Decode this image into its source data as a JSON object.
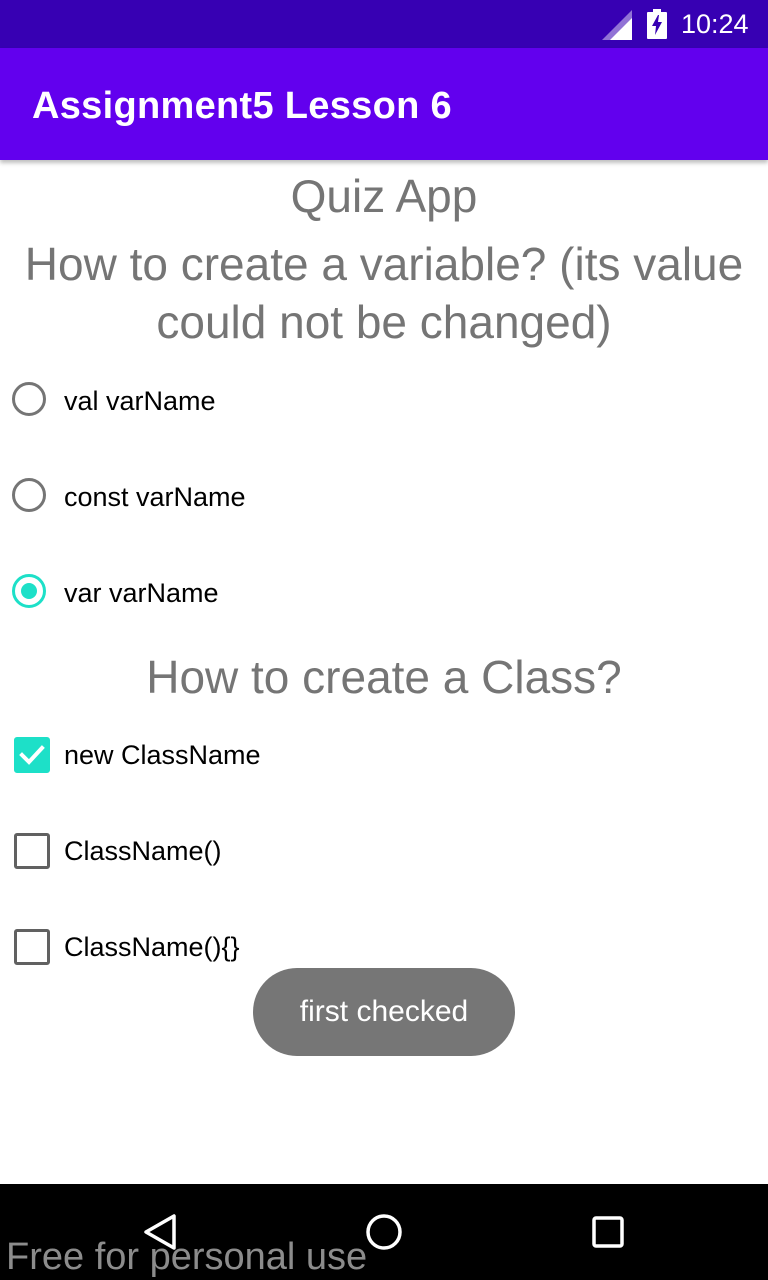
{
  "status_bar": {
    "time": "10:24",
    "icons": [
      "signal-icon",
      "battery-charging-icon"
    ]
  },
  "app_bar": {
    "title": "Assignment5 Lesson 6"
  },
  "content": {
    "quiz_title": "Quiz App",
    "question1": {
      "text": "How to create a variable? (its value could not be changed)",
      "options": [
        {
          "label": "val varName",
          "checked": false
        },
        {
          "label": "const varName",
          "checked": false
        },
        {
          "label": "var varName",
          "checked": true
        }
      ]
    },
    "question2": {
      "text": "How to create a Class?",
      "options": [
        {
          "label": "new ClassName",
          "checked": true
        },
        {
          "label": "ClassName()",
          "checked": false
        },
        {
          "label": "ClassName(){}",
          "checked": false
        }
      ]
    }
  },
  "toast": {
    "text": "first checked"
  },
  "nav_bar": {
    "icons": [
      "back-icon",
      "home-icon",
      "recents-icon"
    ]
  },
  "watermark": "Free for personal use",
  "colors": {
    "status_bar": "#3700b3",
    "app_bar": "#6200ee",
    "accent": "#1de0c8",
    "heading_text": "#757575",
    "toast_bg": "#767676"
  }
}
